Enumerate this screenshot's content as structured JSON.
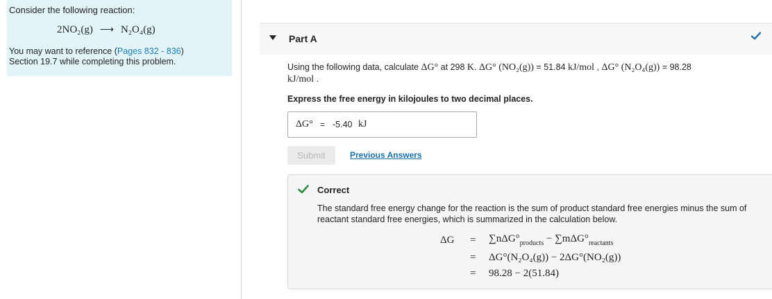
{
  "problem": {
    "intro": "Consider the following reaction:",
    "reaction_left": "2NO₂(g)",
    "reaction_arrow": "⟶",
    "reaction_right": "N₂O₄(g)",
    "ref_prefix": "You may want to reference (",
    "ref_link": "Pages 832 - 836",
    "ref_suffix": ")",
    "ref_line2": "Section 19.7 while completing this problem."
  },
  "part": {
    "title": "Part A",
    "caret_icon": "caret-down-icon",
    "status_icon": "checkmark-icon"
  },
  "question": {
    "text_1": "Using the following data, calculate ",
    "symbol": "ΔG°",
    "text_2": " at 298 ",
    "unit_K": "K",
    "text_3": ". ",
    "given_1_label": "ΔG° (NO₂(g))",
    "given_1_value": " = 51.84 ",
    "given_1_unit": "kJ/mol",
    "sep": " , ",
    "given_2_label": "ΔG° (N₂O₄(g))",
    "given_2_value": " = 98.28 ",
    "given_2_unit": "kJ/mol",
    "end": " ."
  },
  "instruction": "Express the free energy in kilojoules to two decimal places.",
  "answer": {
    "label": "ΔG°",
    "equals": "=",
    "value": "-5.40",
    "unit": "kJ"
  },
  "buttons": {
    "submit": "Submit",
    "previous_answers": "Previous Answers"
  },
  "feedback": {
    "title": "Correct",
    "text": "The standard free energy change for the reaction is the sum of product standard free energies minus the sum of reactant standard free energies, which is summarized in the calculation below.",
    "calc": {
      "lhs": "ΔG",
      "eq": "=",
      "r1_a": "∑nΔG°",
      "r1_sub_a": "products",
      "r1_mid": " − ∑mΔG°",
      "r1_sub_b": "reactants",
      "r2": "ΔG°(N₂O₄(g)) − 2ΔG°(NO₂(g))",
      "r3": "98.28 − 2(51.84)"
    }
  },
  "colors": {
    "panel_bg": "#e3f4f8",
    "link": "#1a7fb4",
    "check": "#2a8a3e",
    "status_check": "#1f6fb0"
  }
}
